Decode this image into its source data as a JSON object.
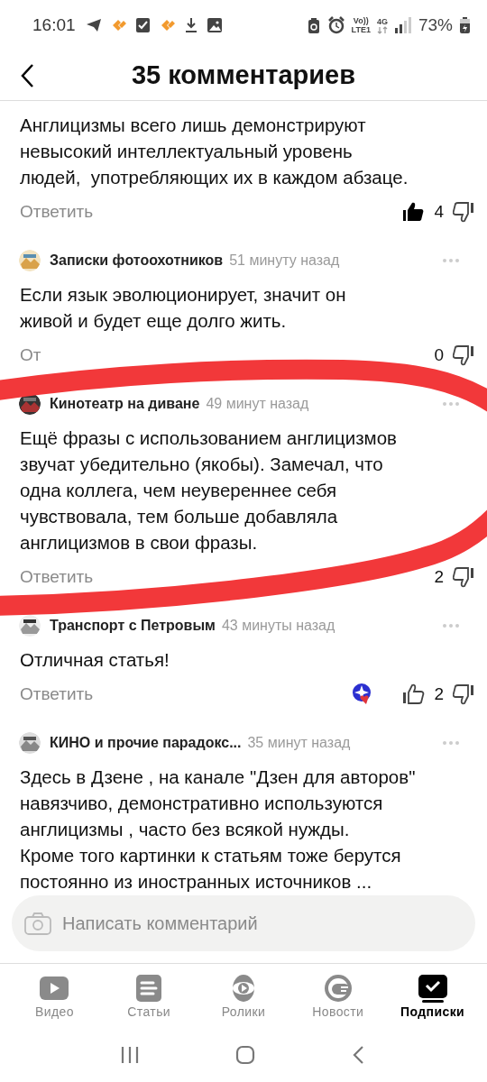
{
  "status_bar": {
    "time": "16:01",
    "volte": "Vo))",
    "lte": "LTE1",
    "network": "4G",
    "battery": "73%"
  },
  "header": {
    "title": "35 комментариев"
  },
  "comments": [
    {
      "text": "Англицизмы всего лишь демонстрируют\nневысокий интеллектуальный уровень\nлюдей,  употребляющих их в каждом абзаце.",
      "reply": "Ответить",
      "liked": true,
      "likes": "4"
    },
    {
      "author": "Записки фотоохотников",
      "time": "51 минуту назад",
      "text": "Если язык эволюционирует, значит он\nживой и будет еще долго жить.",
      "reply": "От",
      "likes": "0"
    },
    {
      "author": "Кинотеатр на диване",
      "time": "49 минут назад",
      "text": "Ещё фразы с использованием англицизмов\nзвучат убедительно (якобы). Замечал, что\nодна коллега, чем неувереннее себя\nчувствовала, тем больше добавляла\nанглицизмов в свои фразы.",
      "reply": "Ответить",
      "likes": "2"
    },
    {
      "author": "Транспорт с Петровым",
      "time": "43 минуты назад",
      "text": "Отличная статья!",
      "reply": "Ответить",
      "reaction": true,
      "liked": false,
      "likes": "2"
    },
    {
      "author": "КИНО и прочие парадокс...",
      "time": "35 минут назад",
      "text": "Здесь в Дзене , на канале \"Дзен для авторов\"\nнавязчиво, демонстративно используются\nанглицизмы , часто без всякой нужды.\nКроме того картинки к статьям тоже берутся\nпостоянно из иностранных источников ..."
    }
  ],
  "composer": {
    "placeholder": "Написать комментарий"
  },
  "nav": [
    {
      "label": "Видео",
      "selected": false
    },
    {
      "label": "Статьи",
      "selected": false
    },
    {
      "label": "Ролики",
      "selected": false
    },
    {
      "label": "Новости",
      "selected": false
    },
    {
      "label": "Подписки",
      "selected": true
    }
  ]
}
